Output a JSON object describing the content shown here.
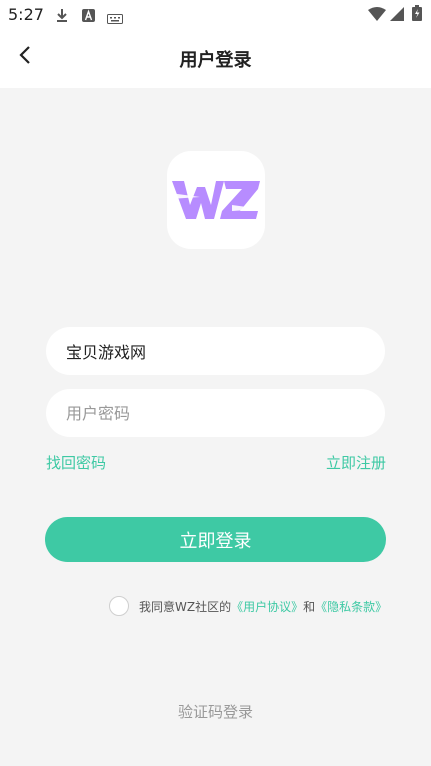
{
  "status_bar": {
    "time": "5:27"
  },
  "nav": {
    "title": "用户登录"
  },
  "logo": {
    "text": "WZ",
    "color": "#b78cff"
  },
  "form": {
    "username_value": "宝贝游戏网",
    "password_placeholder": "用户密码"
  },
  "links": {
    "forgot": "找回密码",
    "register": "立即注册"
  },
  "login_button": "立即登录",
  "agreement": {
    "prefix": "我同意WZ社区的",
    "user_agreement": "《用户协议》",
    "and": "和",
    "privacy": "《隐私条款》"
  },
  "sms_login": "验证码登录",
  "colors": {
    "accent": "#3ec9a4",
    "background": "#f4f4f4"
  }
}
